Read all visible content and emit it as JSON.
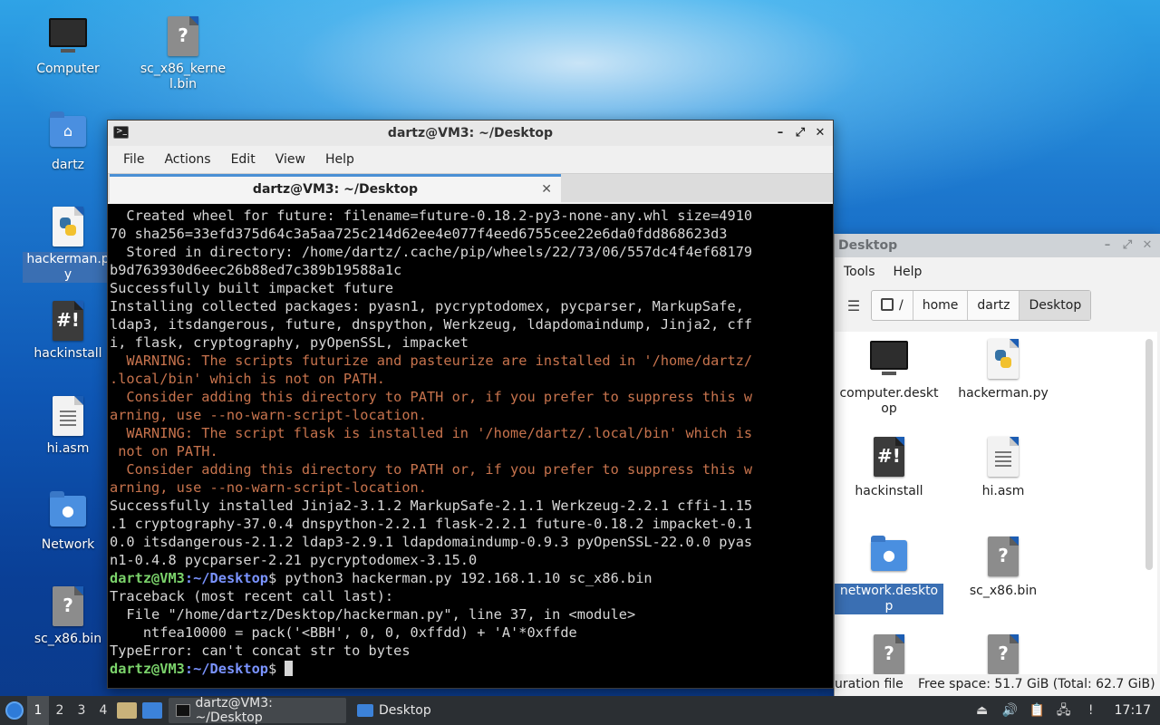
{
  "desktop_icons": [
    {
      "label": "Computer",
      "kind": "monitor"
    },
    {
      "label": "sc_x86_kernel.bin",
      "kind": "unknown-file"
    },
    {
      "label": "dartz",
      "kind": "home-folder"
    },
    {
      "label": "hackerman.py",
      "kind": "python-file"
    },
    {
      "label": "hackinstall",
      "kind": "script-file"
    },
    {
      "label": "hi.asm",
      "kind": "text-file"
    },
    {
      "label": "Network",
      "kind": "network-folder"
    },
    {
      "label": "sc_x86.bin",
      "kind": "unknown-file"
    }
  ],
  "terminal": {
    "title": "dartz@VM3: ~/Desktop",
    "tab_label": "dartz@VM3: ~/Desktop",
    "menu": [
      "File",
      "Actions",
      "Edit",
      "View",
      "Help"
    ],
    "prompt_user": "dartz@VM3",
    "prompt_path": ":~/Desktop",
    "prompt_suffix": "$ ",
    "lines": [
      "  Created wheel for future: filename=future-0.18.2-py3-none-any.whl size=4910",
      "70 sha256=33efd375d64c3a5aa725c214d62ee4e077f4eed6755cee22e6da0fdd868623d3",
      "  Stored in directory: /home/dartz/.cache/pip/wheels/22/73/06/557dc4f4ef68179",
      "b9d763930d6eec26b88ed7c389b19588a1c",
      "Successfully built impacket future",
      "Installing collected packages: pyasn1, pycryptodomex, pycparser, MarkupSafe,",
      "ldap3, itsdangerous, future, dnspython, Werkzeug, ldapdomaindump, Jinja2, cff",
      "i, flask, cryptography, pyOpenSSL, impacket",
      "  WARNING: The scripts futurize and pasteurize are installed in '/home/dartz/",
      ".local/bin' which is not on PATH.",
      "  Consider adding this directory to PATH or, if you prefer to suppress this w",
      "arning, use --no-warn-script-location.",
      "  WARNING: The script flask is installed in '/home/dartz/.local/bin' which is",
      " not on PATH.",
      "  Consider adding this directory to PATH or, if you prefer to suppress this w",
      "arning, use --no-warn-script-location.",
      "Successfully installed Jinja2-3.1.2 MarkupSafe-2.1.1 Werkzeug-2.2.1 cffi-1.15",
      ".1 cryptography-37.0.4 dnspython-2.2.1 flask-2.2.1 future-0.18.2 impacket-0.1",
      "0.0 itsdangerous-2.1.2 ldap3-2.9.1 ldapdomaindump-0.9.3 pyOpenSSL-22.0.0 pyas",
      "n1-0.4.8 pycparser-2.21 pycryptodomex-3.15.0"
    ],
    "command": "python3 hackerman.py 192.168.1.10 sc_x86.bin",
    "trace_lines": [
      "Traceback (most recent call last):",
      "  File \"/home/dartz/Desktop/hackerman.py\", line 37, in <module>",
      "    ntfea10000 = pack('<BBH', 0, 0, 0xffdd) + 'A'*0xffde",
      "TypeError: can't concat str to bytes"
    ]
  },
  "file_manager": {
    "title": "Desktop",
    "menu": [
      "Tools",
      "Help"
    ],
    "breadcrumb": [
      "/",
      "home",
      "dartz",
      "Desktop"
    ],
    "items": [
      {
        "label": "computer.desktop",
        "kind": "monitor"
      },
      {
        "label": "hackerman.py",
        "kind": "python-file"
      },
      {
        "label": "hackinstall",
        "kind": "script-file"
      },
      {
        "label": "hi.asm",
        "kind": "text-file"
      },
      {
        "label": "network.desktop",
        "kind": "network-folder"
      },
      {
        "label": "sc_x86.bin",
        "kind": "unknown-file"
      },
      {
        "label": "",
        "kind": "unknown-file"
      },
      {
        "label": "",
        "kind": "unknown-file"
      }
    ],
    "status_left": "uration file",
    "status_right": "Free space: 51.7 GiB (Total: 62.7 GiB)"
  },
  "panel": {
    "workspaces": [
      "1",
      "2",
      "3",
      "4"
    ],
    "tasks": [
      "dartz@VM3: ~/Desktop",
      "Desktop"
    ],
    "clock": "17:17"
  }
}
